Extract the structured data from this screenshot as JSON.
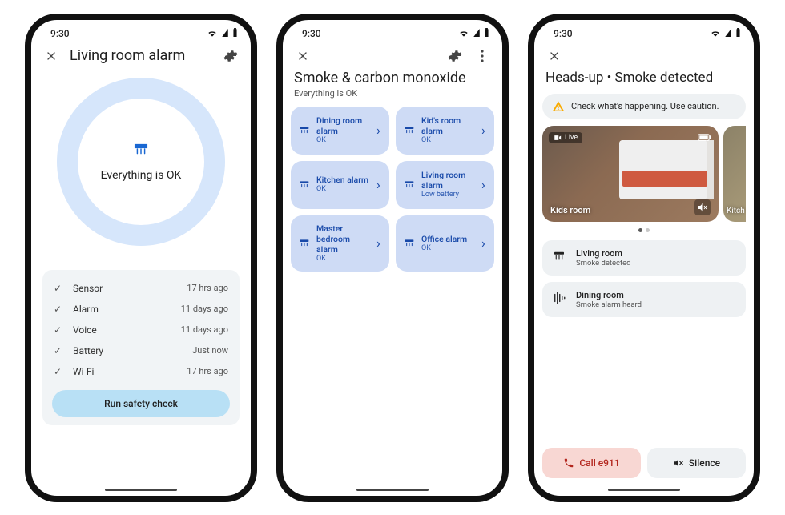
{
  "common": {
    "time": "9:30"
  },
  "phone1": {
    "title": "Living room alarm",
    "circle_status": "Everything is OK",
    "checks": [
      {
        "label": "Sensor",
        "time": "17 hrs ago"
      },
      {
        "label": "Alarm",
        "time": "11 days ago"
      },
      {
        "label": "Voice",
        "time": "11 days ago"
      },
      {
        "label": "Battery",
        "time": "Just now"
      },
      {
        "label": "Wi-Fi",
        "time": "17 hrs ago"
      }
    ],
    "safety_button": "Run safety check"
  },
  "phone2": {
    "title": "Smoke & carbon monoxide",
    "subtitle": "Everything is OK",
    "devices": [
      {
        "name": "Dining room alarm",
        "status": "OK"
      },
      {
        "name": "Kid's room alarm",
        "status": "OK"
      },
      {
        "name": "Kitchen alarm",
        "status": "OK"
      },
      {
        "name": "Living room alarm",
        "status": "Low battery"
      },
      {
        "name": "Master bedroom alarm",
        "status": "OK"
      },
      {
        "name": "Office alarm",
        "status": "OK"
      }
    ]
  },
  "phone3": {
    "title": "Heads-up • Smoke detected",
    "warning": "Check what's happening. Use caution.",
    "cameras": [
      {
        "label": "Kids room",
        "live": "Live"
      },
      {
        "label": "Kitch"
      }
    ],
    "alerts": [
      {
        "room": "Living room",
        "sub": "Smoke detected",
        "icon": "smoke"
      },
      {
        "room": "Dining room",
        "sub": "Smoke alarm heard",
        "icon": "sound"
      }
    ],
    "actions": {
      "call": "Call e911",
      "silence": "Silence"
    }
  }
}
